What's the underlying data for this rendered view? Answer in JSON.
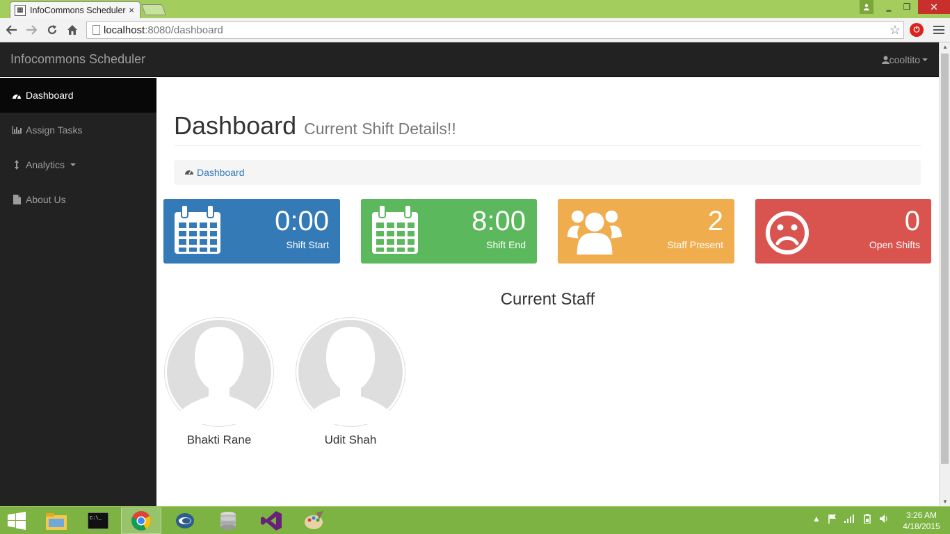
{
  "browser": {
    "tab_title": "InfoCommons Scheduler",
    "tab_close": "×",
    "url_host": "localhost",
    "url_path": ":8080/dashboard",
    "window_close": "✕",
    "window_min": "‗",
    "window_max": "❐"
  },
  "app": {
    "brand": "Infocommons Scheduler",
    "user": "cooltito"
  },
  "sidebar": {
    "items": [
      {
        "label": "Dashboard",
        "icon": "dashboard-icon",
        "active": true
      },
      {
        "label": "Assign Tasks",
        "icon": "bar-chart-icon",
        "active": false
      },
      {
        "label": "Analytics",
        "icon": "arrows-v-icon",
        "active": false
      },
      {
        "label": "About Us",
        "icon": "file-icon",
        "active": false
      }
    ]
  },
  "page": {
    "title": "Dashboard",
    "subtitle": "Current Shift Details!!",
    "breadcrumb": "Dashboard"
  },
  "panels": [
    {
      "value": "0:00",
      "label": "Shift Start",
      "color": "#337ab7",
      "icon": "calendar-icon"
    },
    {
      "value": "8:00",
      "label": "Shift End",
      "color": "#5cb85c",
      "icon": "calendar-icon"
    },
    {
      "value": "2",
      "label": "Staff Present",
      "color": "#f0ad4e",
      "icon": "users-icon"
    },
    {
      "value": "0",
      "label": "Open Shifts",
      "color": "#d9534f",
      "icon": "frown-icon"
    }
  ],
  "staff": {
    "heading": "Current Staff",
    "members": [
      {
        "name": "Bhakti Rane"
      },
      {
        "name": "Udit Shah"
      }
    ]
  },
  "taskbar": {
    "time": "3:26 AM",
    "date": "4/18/2015"
  }
}
